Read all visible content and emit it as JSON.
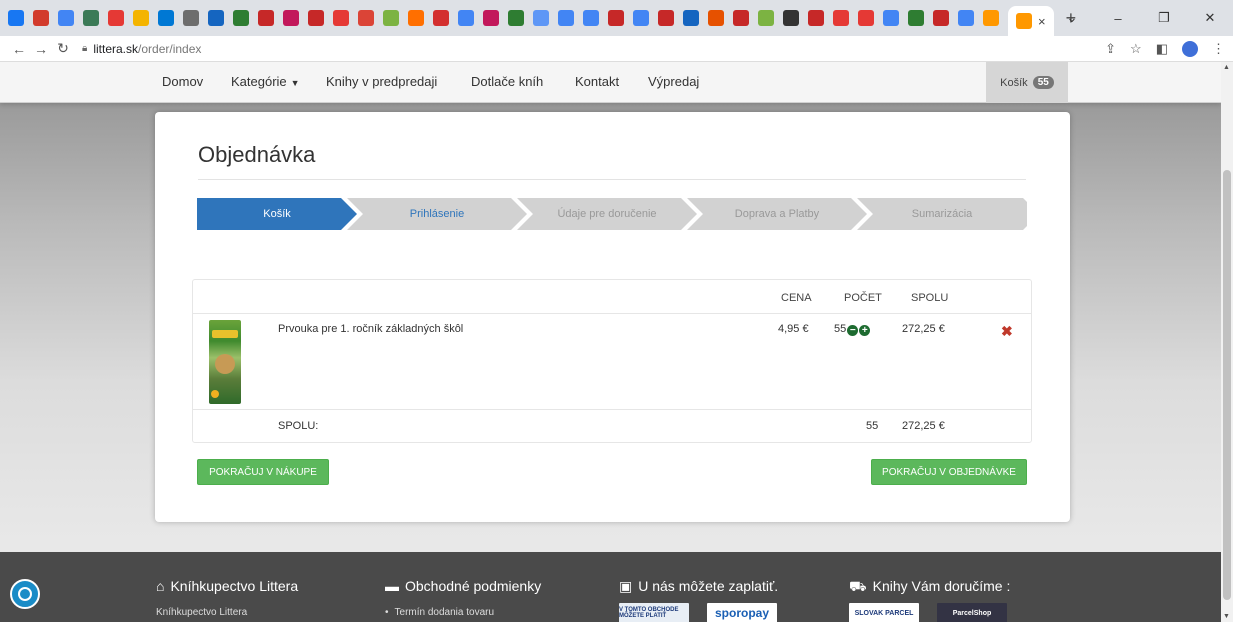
{
  "browser": {
    "favicon_colors": [
      "#1877f2",
      "#d23b2c",
      "#4285f4",
      "#3b7a57",
      "#e53935",
      "#f4b400",
      "#0078d4",
      "#6d6d6d",
      "#1565c0",
      "#2e7d32",
      "#c62828",
      "#c2185b",
      "#c62828",
      "#e53935",
      "#db4437",
      "#7cb342",
      "#ff6f00",
      "#d32f2f",
      "#4285f4",
      "#c2185b",
      "#2e7d32",
      "#5e97f6",
      "#4285f4",
      "#4285f4",
      "#c62828",
      "#4285f4",
      "#c62828",
      "#1565c0",
      "#e65100",
      "#c62828",
      "#7cb342",
      "#333333",
      "#c62828",
      "#e53935",
      "#e53935",
      "#4285f4",
      "#2e7d32",
      "#c62828",
      "#4285f4",
      "#ff9800"
    ],
    "close_tab": "×",
    "new_tab": "+",
    "url_domain": "littera.sk",
    "url_path": "/order/index"
  },
  "nav": {
    "items": [
      "Domov",
      "Kategórie",
      "Knihy v predpredaji",
      "Dotlače kníh",
      "Kontakt",
      "Výpredaj"
    ],
    "cart_label": "Košík",
    "cart_count": "55"
  },
  "order": {
    "title": "Objednávka",
    "steps": [
      "Košík",
      "Prihlásenie",
      "Údaje pre doručenie",
      "Doprava a Platby",
      "Sumarizácia"
    ],
    "headers": {
      "price": "CENA",
      "qty": "POČET",
      "total": "SPOLU"
    },
    "item": {
      "name": "Prvouka pre 1. ročník základných škôl",
      "price": "4,95 €",
      "qty": "55",
      "total": "272,25 €"
    },
    "sum": {
      "label": "SPOLU:",
      "qty": "55",
      "total": "272,25 €"
    },
    "continue_shopping": "POKRAČUJ V NÁKUPE",
    "continue_order": "POKRAČUJ V OBJEDNÁVKE"
  },
  "footer": {
    "col1_title": "Kníhkupectvo Littera",
    "col1_sub": "Kníhkupectvo Littera",
    "col2_title": "Obchodné podmienky",
    "col2_sub": "Termín dodania tovaru",
    "col3_title": "U nás môžete zaplatiť.",
    "col4_title": "Knihy Vám doručíme :",
    "logo1": "V TOMTO OBCHODE MÔŽETE PLATIŤ",
    "logo2": "sporopay",
    "logo3": "SLOVAK PARCEL",
    "logo4": "ParcelShop"
  }
}
